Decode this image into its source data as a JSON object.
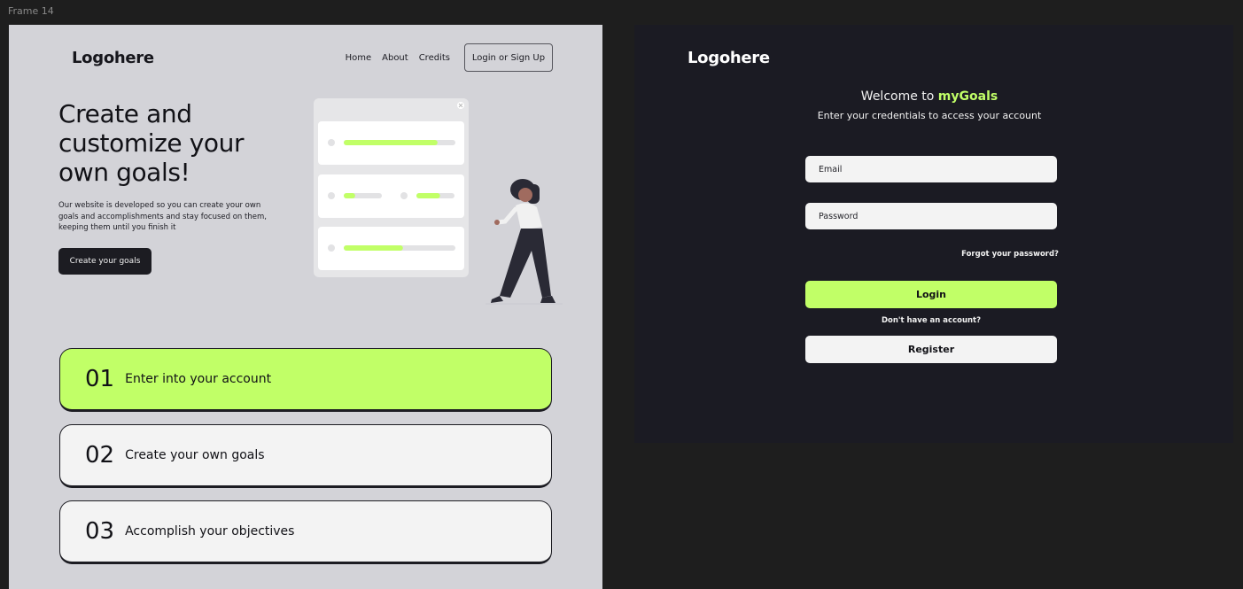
{
  "canvas": {
    "frame_label": "Frame 14"
  },
  "landing": {
    "logo": "Logohere",
    "nav": {
      "home": "Home",
      "about": "About",
      "credits": "Credits",
      "login_signup": "Login or Sign Up"
    },
    "hero": {
      "title_line1": "Create and",
      "title_line2": "customize your",
      "title_line3": "own goals!",
      "description": "Our website is developed so you can create your own goals and accomplishments and stay focused on them, keeping them until you finish it",
      "cta": "Create your goals"
    },
    "steps": [
      {
        "number": "01",
        "label": "Enter into your account",
        "active": true
      },
      {
        "number": "02",
        "label": "Create your own goals",
        "active": false
      },
      {
        "number": "03",
        "label": "Accomplish your objectives",
        "active": false
      }
    ],
    "illustration": {
      "progress_rows": [
        {
          "bars": [
            0.84
          ]
        },
        {
          "bars": [
            0.3,
            0.62
          ]
        },
        {
          "bars": [
            0.53
          ]
        }
      ]
    }
  },
  "login": {
    "logo": "Logohere",
    "welcome_prefix": "Welcome to",
    "brand": "myGoals",
    "subtitle": "Enter your credentials to access your account",
    "email_placeholder": "Email",
    "password_placeholder": "Password",
    "forgot": "Forgot your password?",
    "login_button": "Login",
    "no_account": "Don't have an account?",
    "register_button": "Register"
  },
  "colors": {
    "accent": "#c1ff67",
    "dark": "#1b1b23",
    "light_bg": "#d3d3d8",
    "card": "#f3f3f3",
    "canvas": "#1e1e1e"
  }
}
